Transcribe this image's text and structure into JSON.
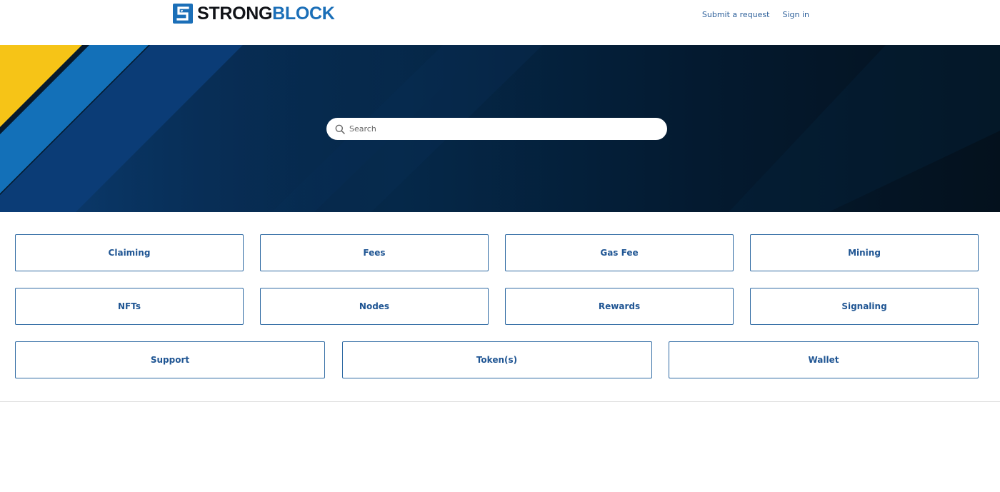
{
  "header": {
    "logo": {
      "part1": "STRONG",
      "part2": "BLOCK"
    },
    "nav": {
      "submit_request": "Submit a request",
      "sign_in": "Sign in"
    }
  },
  "hero": {
    "search": {
      "placeholder": "Search",
      "value": ""
    }
  },
  "categories": [
    "Claiming",
    "Fees",
    "Gas Fee",
    "Mining",
    "NFTs",
    "Nodes",
    "Rewards",
    "Signaling",
    "Support",
    "Token(s)",
    "Wallet"
  ],
  "colors": {
    "brand_blue": "#1b6fb8",
    "brand_dark": "#111318",
    "link": "#2c5f9a",
    "card_border": "#2f6aa3",
    "hero_dark": "#041a30",
    "stripe_yellow": "#f6c417"
  },
  "icons": {
    "logo": "strongblock-s-icon",
    "search": "search-icon"
  }
}
